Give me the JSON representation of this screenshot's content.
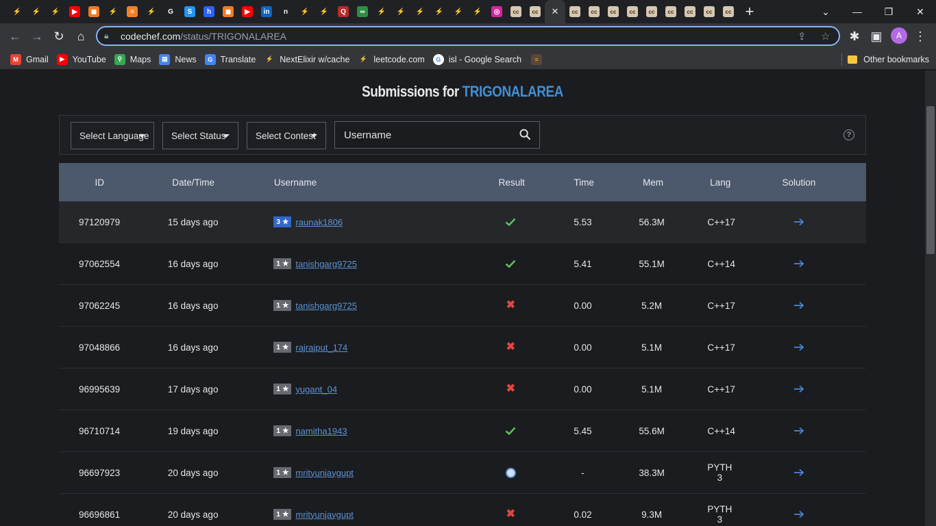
{
  "browser": {
    "tabs": [
      {
        "icon": "codechef-icon",
        "color": "#5b4638"
      },
      {
        "icon": "codechef-icon",
        "color": "#5b4638"
      },
      {
        "icon": "codechef-icon",
        "color": "#5b4638"
      },
      {
        "icon": "youtube-icon",
        "color": "#ff0000"
      },
      {
        "icon": "codingninjas-icon",
        "color": "#f27a21"
      },
      {
        "icon": "codechef-icon",
        "color": "#5b4638"
      },
      {
        "icon": "stackoverflow-icon",
        "color": "#f48024"
      },
      {
        "icon": "codechef-icon",
        "color": "#5b4638"
      },
      {
        "icon": "google-icon",
        "color": "#ffffff"
      },
      {
        "icon": "shortcut-icon",
        "color": "#2196f3"
      },
      {
        "icon": "hashnode-icon",
        "color": "#2962ff"
      },
      {
        "icon": "codingninjas-icon",
        "color": "#f27a21"
      },
      {
        "icon": "youtube-icon",
        "color": "#ff0000"
      },
      {
        "icon": "linkedin-icon",
        "color": "#0a66c2"
      },
      {
        "icon": "notion-icon",
        "color": "#ffffff"
      },
      {
        "icon": "codechef-icon",
        "color": "#5b4638"
      },
      {
        "icon": "codechef-icon",
        "color": "#5b4638"
      },
      {
        "icon": "quora-icon",
        "color": "#b92b27"
      },
      {
        "icon": "geeksforgeeks-icon",
        "color": "#2f8d46"
      },
      {
        "icon": "codechef-icon",
        "color": "#5b4638"
      },
      {
        "icon": "codechef-icon",
        "color": "#5b4638"
      },
      {
        "icon": "codechef-icon",
        "color": "#5b4638"
      },
      {
        "icon": "codechef-icon",
        "color": "#5b4638"
      },
      {
        "icon": "codechef-icon",
        "color": "#5b4638"
      },
      {
        "icon": "codechef-icon",
        "color": "#5b4638"
      },
      {
        "icon": "instagram-icon",
        "color": "#d6249f"
      },
      {
        "icon": "cc-icon",
        "color": "#d6c7b0"
      },
      {
        "icon": "cc-icon",
        "color": "#d6c7b0"
      }
    ],
    "active_tab_close": "✕",
    "tabs_after": 9,
    "url_domain": "codechef.com",
    "url_path": "/status/TRIGONALAREA",
    "profile_initial": "A",
    "bookmarks": [
      {
        "label": "Gmail",
        "icon": "gmail-icon",
        "color": "#ea4335"
      },
      {
        "label": "YouTube",
        "icon": "youtube-icon",
        "color": "#ff0000"
      },
      {
        "label": "Maps",
        "icon": "maps-icon",
        "color": "#34a853"
      },
      {
        "label": "News",
        "icon": "news-icon",
        "color": "#4285f4"
      },
      {
        "label": "Translate",
        "icon": "translate-icon",
        "color": "#4285f4"
      },
      {
        "label": "NextElixir w/cache",
        "icon": "codechef-icon",
        "color": "#5b4638"
      },
      {
        "label": "leetcode.com",
        "icon": "codechef-icon",
        "color": "#5b4638"
      },
      {
        "label": "isl - Google Search",
        "icon": "google-icon",
        "color": "#ffffff"
      }
    ],
    "other_bookmarks": "Other bookmarks"
  },
  "page": {
    "title_prefix": "Submissions for",
    "problem_code": "TRIGONALAREA",
    "filters": {
      "language": "Select Language",
      "status": "Select Status",
      "contest": "Select Contest",
      "username_placeholder": "Username"
    },
    "help": "?",
    "columns": [
      "ID",
      "Date/Time",
      "Username",
      "Result",
      "Time",
      "Mem",
      "Lang",
      "Solution"
    ],
    "rows": [
      {
        "id": "97120979",
        "date": "15 days ago",
        "stars": "3 ★",
        "rating": 3,
        "user": "raunak1806",
        "result": "accepted",
        "time": "5.53",
        "mem": "56.3M",
        "lang": "C++17"
      },
      {
        "id": "97062554",
        "date": "16 days ago",
        "stars": "1 ★",
        "rating": 1,
        "user": "tanishgarg9725",
        "result": "accepted",
        "time": "5.41",
        "mem": "55.1M",
        "lang": "C++14"
      },
      {
        "id": "97062245",
        "date": "16 days ago",
        "stars": "1 ★",
        "rating": 1,
        "user": "tanishgarg9725",
        "result": "wrong",
        "time": "0.00",
        "mem": "5.2M",
        "lang": "C++17"
      },
      {
        "id": "97048866",
        "date": "16 days ago",
        "stars": "1 ★",
        "rating": 1,
        "user": "rajrajput_174",
        "result": "wrong",
        "time": "0.00",
        "mem": "5.1M",
        "lang": "C++17"
      },
      {
        "id": "96995639",
        "date": "17 days ago",
        "stars": "1 ★",
        "rating": 1,
        "user": "yugant_04",
        "result": "wrong",
        "time": "0.00",
        "mem": "5.1M",
        "lang": "C++17"
      },
      {
        "id": "96710714",
        "date": "19 days ago",
        "stars": "1 ★",
        "rating": 1,
        "user": "namitha1943",
        "result": "accepted",
        "time": "5.45",
        "mem": "55.6M",
        "lang": "C++14"
      },
      {
        "id": "96697923",
        "date": "20 days ago",
        "stars": "1 ★",
        "rating": 1,
        "user": "mrityunjaygupt",
        "result": "tle",
        "time": "-",
        "mem": "38.3M",
        "lang": "PYTH 3"
      },
      {
        "id": "96696861",
        "date": "20 days ago",
        "stars": "1 ★",
        "rating": 1,
        "user": "mrityunjaygupt",
        "result": "wrong",
        "time": "0.02",
        "mem": "9.3M",
        "lang": "PYTH 3"
      }
    ]
  }
}
